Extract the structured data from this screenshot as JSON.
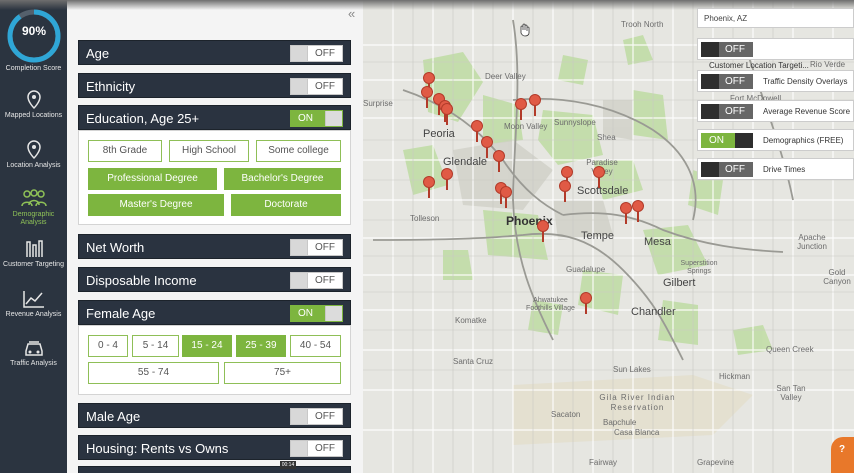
{
  "completion": {
    "value": "90%",
    "label": "Completion Score",
    "fraction": 0.9
  },
  "nav": [
    {
      "label": "Mapped Locations",
      "icon": "map-pin-icon",
      "active": false
    },
    {
      "label": "Location Analysis",
      "icon": "location-analysis-icon",
      "active": false
    },
    {
      "label": "Demographic Analysis",
      "icon": "demographic-people-icon",
      "active": true
    },
    {
      "label": "Customer Targeting",
      "icon": "customer-targeting-icon",
      "active": false
    },
    {
      "label": "Revenue Analysis",
      "icon": "revenue-chart-icon",
      "active": false
    },
    {
      "label": "Traffic Analysis",
      "icon": "car-icon",
      "active": false
    }
  ],
  "panel": {
    "collapse": "«",
    "filters": [
      {
        "title": "Age",
        "state": "OFF"
      },
      {
        "title": "Ethnicity",
        "state": "OFF"
      },
      {
        "title": "Education, Age 25+",
        "state": "ON",
        "options": [
          {
            "label": "8th Grade",
            "selected": false
          },
          {
            "label": "High School",
            "selected": false
          },
          {
            "label": "Some college",
            "selected": false
          },
          {
            "label": "Professional Degree",
            "selected": true
          },
          {
            "label": "Bachelor's Degree",
            "selected": true
          },
          {
            "label": "Master's Degree",
            "selected": true
          },
          {
            "label": "Doctorate",
            "selected": true
          }
        ]
      },
      {
        "title": "Net Worth",
        "state": "OFF"
      },
      {
        "title": "Disposable Income",
        "state": "OFF"
      },
      {
        "title": "Female Age",
        "state": "ON",
        "options": [
          {
            "label": "0 - 4",
            "selected": false
          },
          {
            "label": "5 - 14",
            "selected": false
          },
          {
            "label": "15 - 24",
            "selected": true
          },
          {
            "label": "25 - 39",
            "selected": true
          },
          {
            "label": "40 - 54",
            "selected": false
          },
          {
            "label": "55 - 74",
            "selected": false
          },
          {
            "label": "75+",
            "selected": false
          }
        ]
      },
      {
        "title": "Male Age",
        "state": "OFF"
      },
      {
        "title": "Housing: Rents vs Owns",
        "state": "OFF"
      }
    ],
    "scrub_label": "00:14"
  },
  "map": {
    "location_search": "Phoenix, AZ",
    "overlays": [
      {
        "state": "OFF",
        "label": ""
      },
      {
        "state": "OFF",
        "label": "Traffic Density Overlays"
      },
      {
        "state": "OFF",
        "label": "Average Revenue Score"
      },
      {
        "state": "ON",
        "label": "Demographics (FREE)"
      },
      {
        "state": "OFF",
        "label": "Drive Times"
      }
    ],
    "overlay_sub_label": "Customer Location Targeti...",
    "cities": [
      "Peoria",
      "Glendale",
      "Phoenix",
      "Scottsdale",
      "Tempe",
      "Mesa",
      "Gilbert",
      "Chandler"
    ],
    "places": [
      "Trooh North",
      "Deer Valley",
      "Moon Valley",
      "Sunnyslope",
      "Fort McDowell",
      "Paradise Valley",
      "Shea",
      "Rio Verde",
      "Tolleson",
      "Guadalupe",
      "Komatke",
      "Ahwatukee Foothills Village",
      "Apache Junction",
      "Gold Canyon",
      "Queen Creek",
      "Hickman",
      "San Tan Valley",
      "Sun Lakes",
      "Santa Cruz",
      "Sacaton",
      "Bapchule",
      "Casa Blanca",
      "Gila River Indian Reservation",
      "Superstition Springs",
      "Grapevine",
      "Fairway",
      "Surprise"
    ],
    "chat_icon": "?"
  }
}
